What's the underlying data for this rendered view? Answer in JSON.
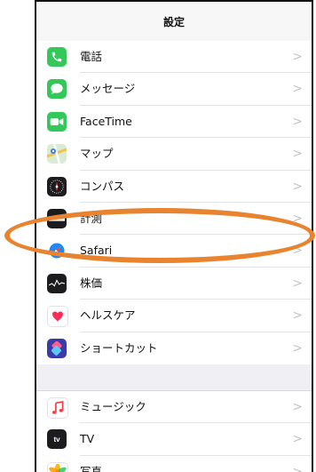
{
  "navbar": {
    "title": "設定"
  },
  "group1": [
    {
      "name": "row-phone",
      "label": "電話",
      "icon": "phone-icon",
      "color": "#34c759"
    },
    {
      "name": "row-messages",
      "label": "メッセージ",
      "icon": "messages-icon",
      "color": "#34c759"
    },
    {
      "name": "row-facetime",
      "label": "FaceTime",
      "icon": "facetime-icon",
      "color": "#34c759"
    },
    {
      "name": "row-maps",
      "label": "マップ",
      "icon": "maps-icon",
      "color": "#8cc0e8"
    },
    {
      "name": "row-compass",
      "label": "コンパス",
      "icon": "compass-icon",
      "color": "#1c1c1e"
    },
    {
      "name": "row-measure",
      "label": "計測",
      "icon": "measure-icon",
      "color": "#1c1c1e"
    },
    {
      "name": "row-safari",
      "label": "Safari",
      "icon": "safari-icon",
      "color": "#1e88f5"
    },
    {
      "name": "row-stocks",
      "label": "株価",
      "icon": "stocks-icon",
      "color": "#1c1c1e"
    },
    {
      "name": "row-health",
      "label": "ヘルスケア",
      "icon": "health-icon",
      "color": "#ff2d55"
    },
    {
      "name": "row-shortcuts",
      "label": "ショートカット",
      "icon": "shortcuts-icon",
      "color": "#3a3aa8"
    }
  ],
  "group2": [
    {
      "name": "row-music",
      "label": "ミュージック",
      "icon": "music-icon",
      "color": "#fc3c44"
    },
    {
      "name": "row-tv",
      "label": "TV",
      "icon": "tv-icon",
      "color": "#1c1c1e"
    },
    {
      "name": "row-photos",
      "label": "写真",
      "icon": "photos-icon",
      "color": "#f5b400"
    }
  ],
  "chevron": ">",
  "tv_icon_text": "tv",
  "annotation_color": "#e8842f"
}
